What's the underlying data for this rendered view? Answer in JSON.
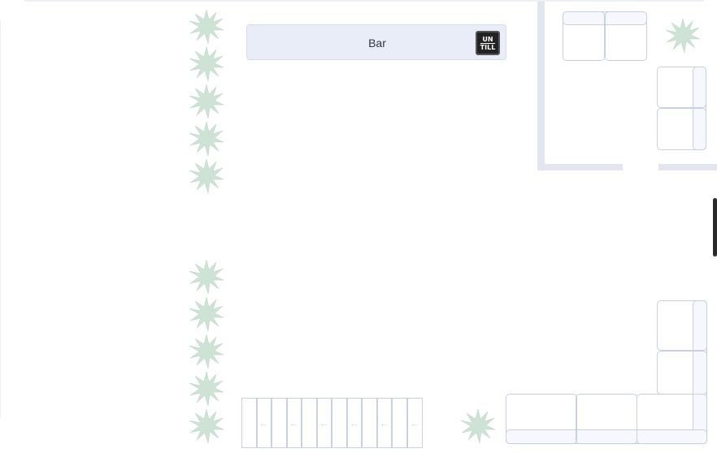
{
  "floor_plan": {
    "bar": {
      "label": "Bar"
    },
    "logo": {
      "line1": "UN",
      "line2": "TILL"
    },
    "stairs": {
      "arrow": "←"
    },
    "icons": {
      "plant": "plant-icon",
      "logo": "untill-logo-icon",
      "stairs": "stairs-arrow-icon"
    }
  },
  "colors": {
    "plant": "#cfe2d6",
    "wall": "#e3e6ee",
    "furniture_outline": "#c9d0e2",
    "bar_fill": "#e9edf7"
  }
}
